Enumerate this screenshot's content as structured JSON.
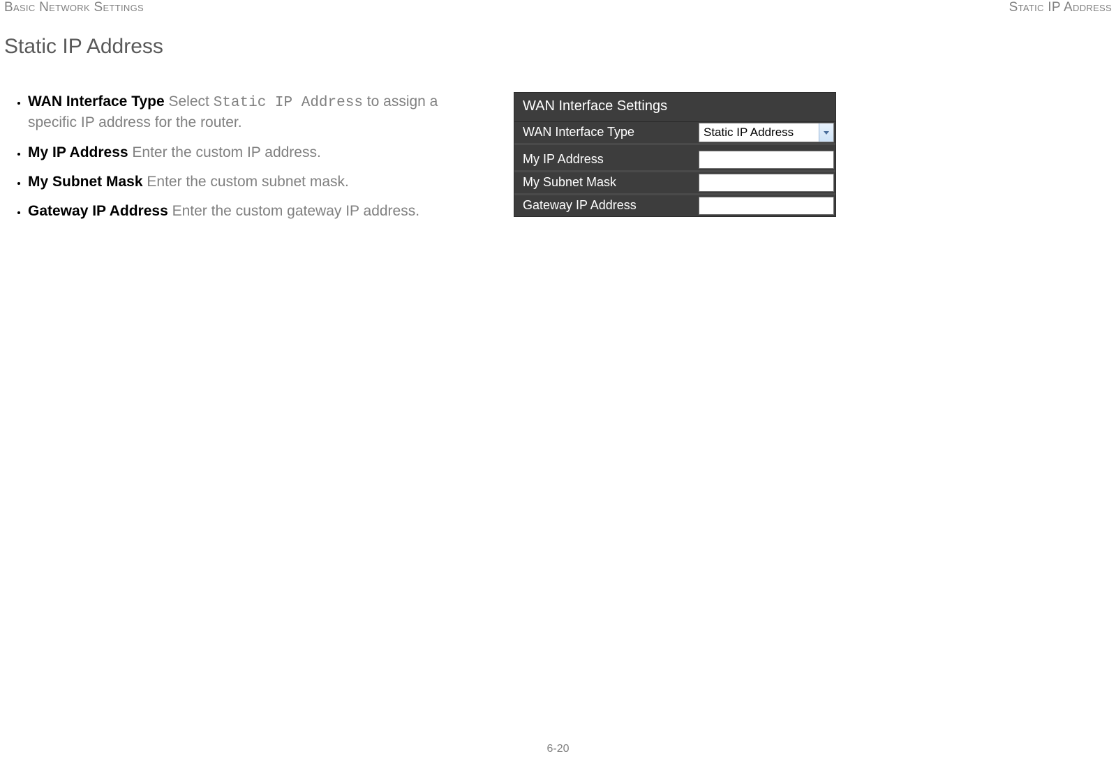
{
  "header": {
    "left": "Basic Network Settings",
    "right": "Static IP Address"
  },
  "title": "Static IP Address",
  "bullets": [
    {
      "term": "WAN Interface Type",
      "pre": "  Select ",
      "code": "Static IP Address",
      "post": " to assign a specific IP address for the router."
    },
    {
      "term": "My IP Address",
      "pre": "  Enter the custom IP address.",
      "code": "",
      "post": ""
    },
    {
      "term": "My Subnet Mask",
      "pre": "  Enter the custom subnet mask.",
      "code": "",
      "post": ""
    },
    {
      "term": "Gateway IP Address",
      "pre": "  Enter the custom gateway IP address.",
      "code": "",
      "post": ""
    }
  ],
  "panel": {
    "title": "WAN Interface Settings",
    "rows": [
      {
        "label": "WAN Interface Type",
        "type": "select",
        "value": "Static IP Address"
      },
      {
        "label": "My IP Address",
        "type": "text",
        "value": ""
      },
      {
        "label": "My Subnet Mask",
        "type": "text",
        "value": ""
      },
      {
        "label": "Gateway IP Address",
        "type": "text",
        "value": ""
      }
    ]
  },
  "page_number": "6-20"
}
